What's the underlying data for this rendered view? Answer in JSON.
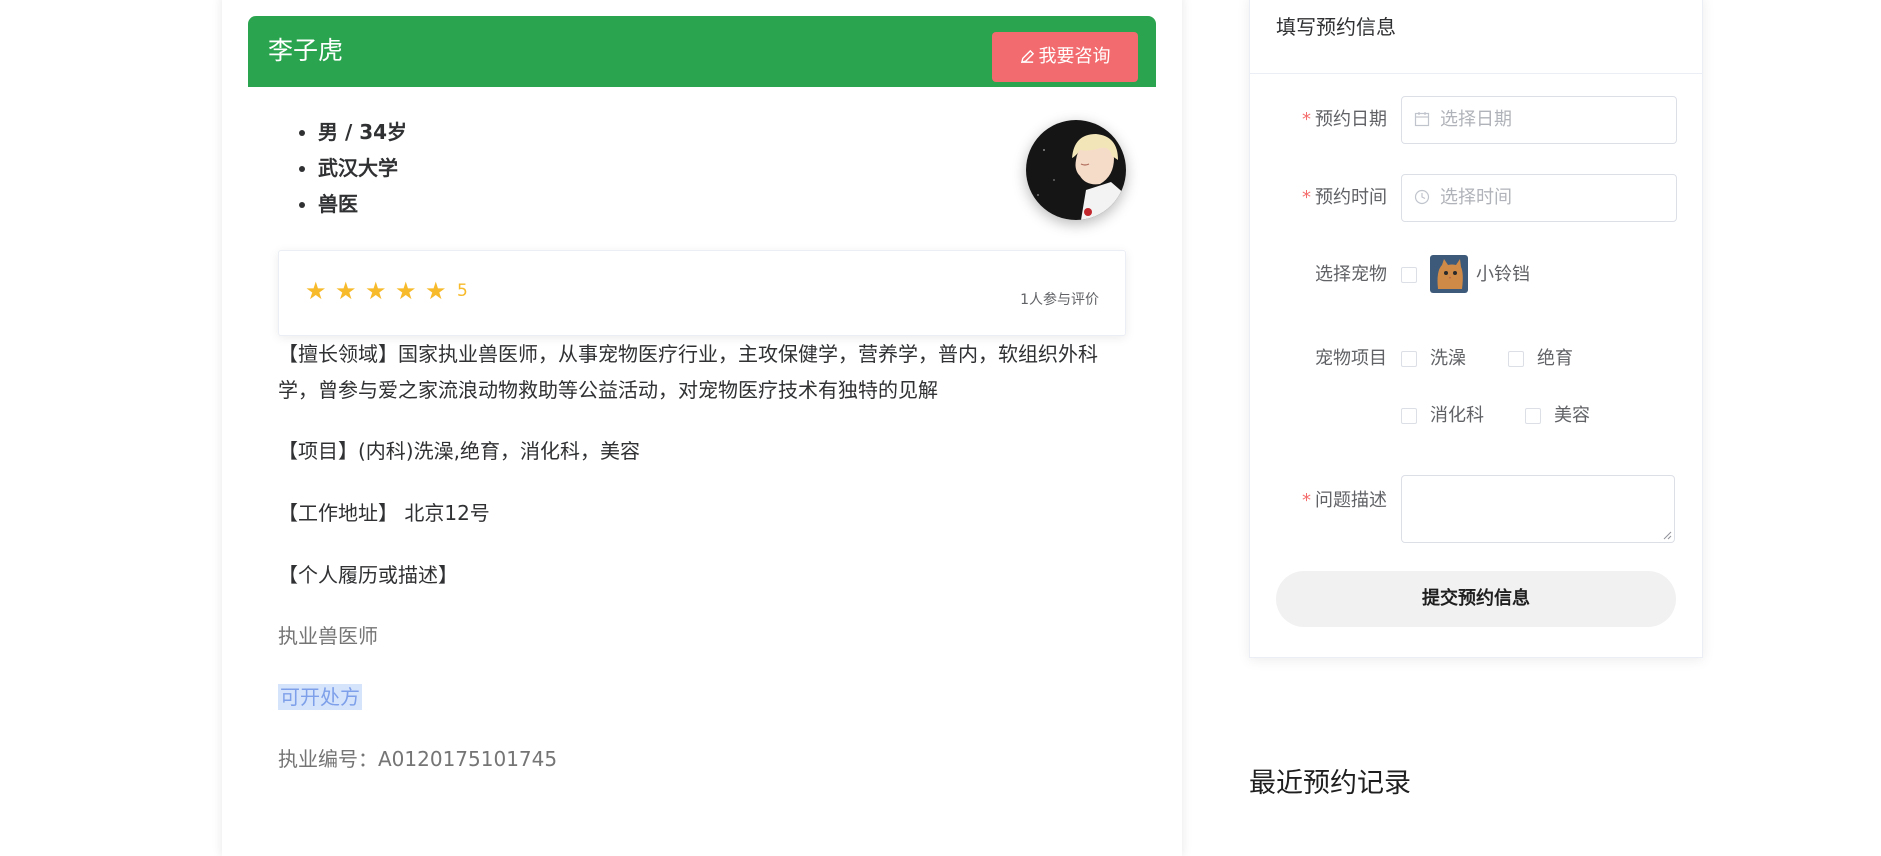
{
  "doctor": {
    "name": "李子虎",
    "consult_button": "我要咨询",
    "info": [
      "男 / 34岁",
      "武汉大学",
      "兽医"
    ],
    "rating": {
      "stars": 5,
      "score": "5",
      "count_text": "1人参与评价"
    },
    "description": "【擅长领域】国家执业兽医师，从事宠物医疗行业，主攻保健学，营养学，普内，软组织外科学，曾参与爱之家流浪动物救助等公益活动，对宠物医疗技术有独特的见解",
    "projects": "【项目】(内科)洗澡,绝育，消化科，美容",
    "address": "【工作地址】 北京12号",
    "resume_heading": "【个人履历或描述】",
    "title_text": "执业兽医师",
    "prescribe_text": "可开处方",
    "license_text": "执业编号：A0120175101745"
  },
  "form": {
    "title": "填写预约信息",
    "date_label": "预约日期",
    "date_placeholder": "选择日期",
    "time_label": "预约时间",
    "time_placeholder": "选择时间",
    "pet_label": "选择宠物",
    "pet_name": "小铃铛",
    "project_label": "宠物项目",
    "projects": [
      "洗澡",
      "绝育",
      "消化科",
      "美容"
    ],
    "problem_label": "问题描述",
    "submit_label": "提交预约信息",
    "required_mark": "*"
  },
  "recent": {
    "title": "最近预约记录"
  },
  "colors": {
    "header_green": "#2aa44f",
    "consult_red": "#f26b6e",
    "star_yellow": "#f7ba2a",
    "required_red": "#f56c6c",
    "prescribe_blue": "#7ea0ea"
  }
}
